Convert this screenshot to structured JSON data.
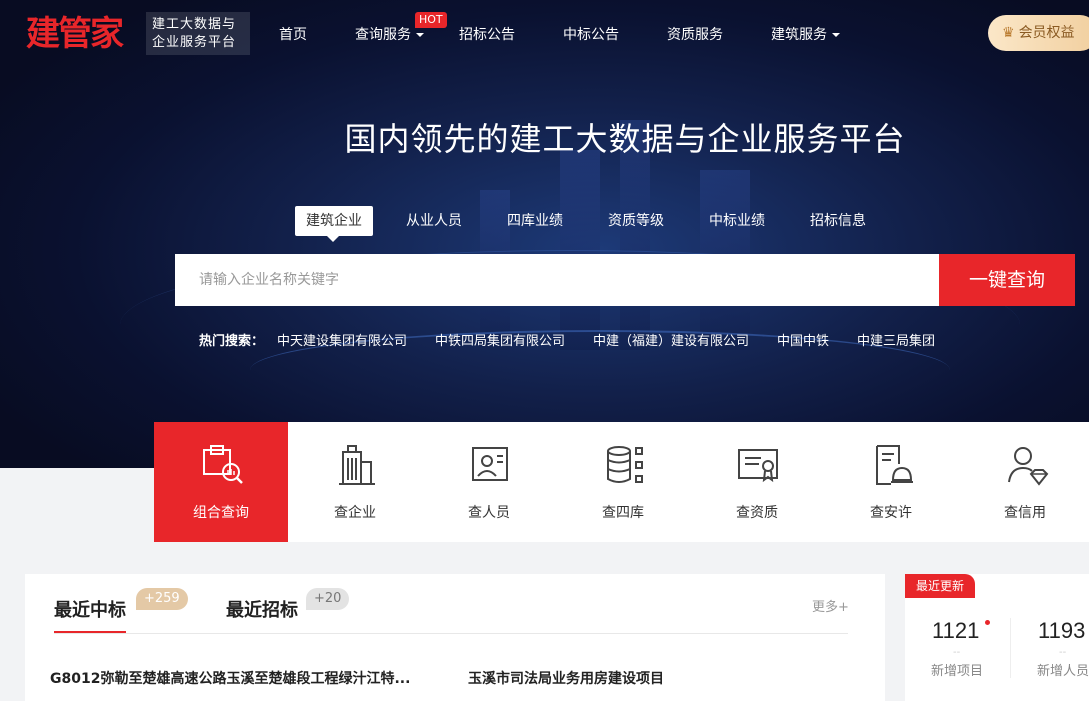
{
  "brand": {
    "logo": "建管家",
    "tagline_line1": "建工大数据与",
    "tagline_line2": "企业服务平台"
  },
  "nav": {
    "items": [
      {
        "label": "首页"
      },
      {
        "label": "查询服务"
      },
      {
        "label": "招标公告"
      },
      {
        "label": "中标公告"
      },
      {
        "label": "资质服务"
      },
      {
        "label": "建筑服务"
      }
    ],
    "hot_badge": "HOT",
    "member_label": "会员权益"
  },
  "hero": {
    "title": "国内领先的建工大数据与企业服务平台"
  },
  "search": {
    "tabs": [
      {
        "label": "建筑企业"
      },
      {
        "label": "从业人员"
      },
      {
        "label": "四库业绩"
      },
      {
        "label": "资质等级"
      },
      {
        "label": "中标业绩"
      },
      {
        "label": "招标信息"
      }
    ],
    "placeholder": "请输入企业名称关键字",
    "button": "一键查询",
    "hot_label": "热门搜索：",
    "hot_items": [
      "中天建设集团有限公司",
      "中铁四局集团有限公司",
      "中建（福建）建设有限公司",
      "中国中铁",
      "中建三局集团"
    ]
  },
  "tiles": [
    {
      "label": "组合查询",
      "icon": "combined-search-icon"
    },
    {
      "label": "查企业",
      "icon": "building-icon"
    },
    {
      "label": "查人员",
      "icon": "person-card-icon"
    },
    {
      "label": "查四库",
      "icon": "database-icon"
    },
    {
      "label": "查资质",
      "icon": "certificate-icon"
    },
    {
      "label": "查安许",
      "icon": "safety-permit-icon"
    },
    {
      "label": "查信用",
      "icon": "credit-icon"
    }
  ],
  "news": {
    "tab1": {
      "label": "最近中标",
      "badge": "+259"
    },
    "tab2": {
      "label": "最近招标",
      "badge": "+20"
    },
    "more": "更多+",
    "items": [
      "G8012弥勒至楚雄高速公路玉溪至楚雄段工程绿汁江特...",
      "玉溪市司法局业务用房建设项目"
    ]
  },
  "recent": {
    "tag": "最近更新",
    "stats": [
      {
        "value": "1121",
        "dash": "--",
        "label": "新增项目"
      },
      {
        "value": "1193",
        "dash": "--",
        "label": "新增人员"
      }
    ]
  },
  "colors": {
    "brand_red": "#e8262a",
    "hero_dark": "#0a1130",
    "gold": "#f1cf9f"
  }
}
